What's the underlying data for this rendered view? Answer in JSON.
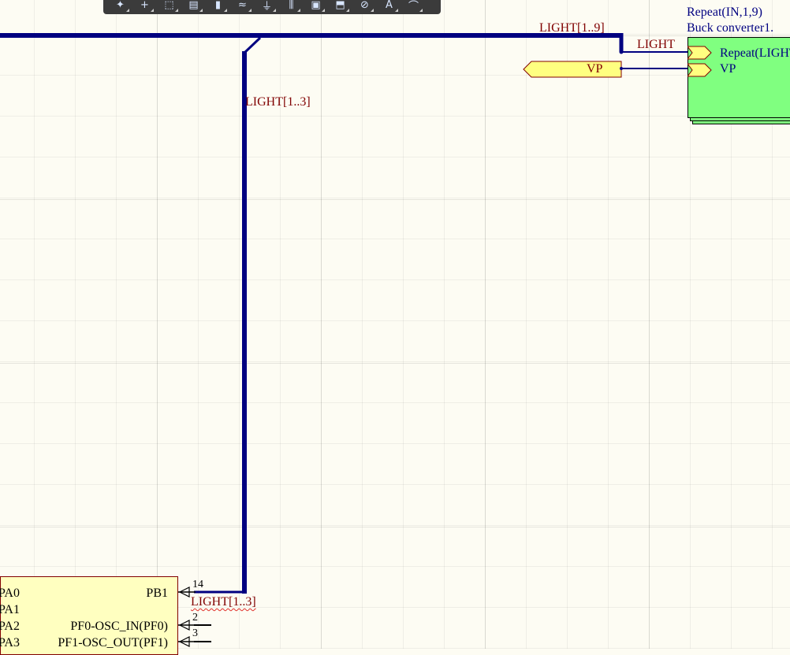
{
  "toolbar": {
    "tools": [
      {
        "name": "place-pointer-icon",
        "glyph": "✦"
      },
      {
        "name": "place-cross-icon",
        "glyph": "+"
      },
      {
        "name": "select-rect-icon",
        "glyph": "⬚"
      },
      {
        "name": "align-icon",
        "glyph": "▤"
      },
      {
        "name": "place-part-icon",
        "glyph": "▮"
      },
      {
        "name": "place-wire-icon",
        "glyph": "≈"
      },
      {
        "name": "place-ground-icon",
        "glyph": "⏚"
      },
      {
        "name": "place-bus-icon",
        "glyph": "⫼"
      },
      {
        "name": "place-sheet-icon",
        "glyph": "▣"
      },
      {
        "name": "place-port-icon",
        "glyph": "⬒"
      },
      {
        "name": "place-no-erc-icon",
        "glyph": "⊘"
      },
      {
        "name": "place-text-icon",
        "glyph": "A"
      },
      {
        "name": "place-arc-icon",
        "glyph": "⌒"
      }
    ]
  },
  "nets": {
    "bus_top": "LIGHT[1..9]",
    "bus_branch": "LIGHT[1..3]",
    "bus_bottom": "LIGHT[1..3]",
    "light": "LIGHT"
  },
  "sheet_symbol": {
    "repeat_label": "Repeat(IN,1,9)",
    "designator": "Buck converter1.",
    "entries": [
      "Repeat(LIGHT",
      "VP"
    ]
  },
  "ports": {
    "vp": "VP"
  },
  "component": {
    "left_pins": [
      "PA0",
      "PA1",
      "PA2",
      "PA3"
    ],
    "right_pins": [
      {
        "name": "PB1",
        "number": "14"
      },
      {
        "name": "PF0-OSC_IN(PF0)",
        "number": "2"
      },
      {
        "name": "PF1-OSC_OUT(PF1)",
        "number": "3"
      }
    ]
  },
  "colors": {
    "background": "#fdfcf3",
    "bus": "#000080",
    "net_label": "#800000",
    "sheet_fill": "#80ff80",
    "component_fill": "#ffffc0",
    "port_fill": "#ffff80"
  }
}
